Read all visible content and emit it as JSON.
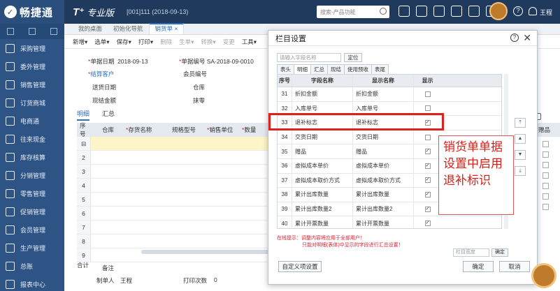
{
  "brand": {
    "logo": "畅捷通",
    "product": "T⁺",
    "product_sub": "专业版",
    "account": "[001]111   (2018-09-13)"
  },
  "topbar": {
    "search_placeholder": "搜索-产品功能",
    "user": "王程",
    "help": "?"
  },
  "sidebar": {
    "items": [
      "采购管理",
      "委外管理",
      "销售管理",
      "订货商城",
      "电商通",
      "往来现金",
      "库存核算",
      "分销管理",
      "零售管理",
      "促销管理",
      "会员管理",
      "生产管理",
      "总账",
      "报表中心"
    ]
  },
  "tabs": [
    "我的桌面",
    "初始化导航",
    "销货单 ×"
  ],
  "toolbar": {
    "items": [
      "新增▾",
      "选单▾",
      "保存▾",
      "打印▾",
      "删除",
      "生单▾",
      "转换▾",
      "变更",
      "工具▾"
    ]
  },
  "form": {
    "date_label": "单据日期",
    "date_value": "2018-09-13",
    "code_label": "单据编号",
    "code_value": "SA-2018-09-0010",
    "customer_label": "结算客户",
    "member_label": "会员编号",
    "delivery_label": "送货日期",
    "warehouse_label": "仓库",
    "cash_label": "现结金额",
    "discount_label": "抹零"
  },
  "subtabs": [
    "明细",
    "汇总"
  ],
  "grid": {
    "headers": [
      "序号",
      "仓库",
      "存货名称",
      "规格型号",
      "销售单位",
      "数量"
    ],
    "rows": [
      "2",
      "3",
      "4",
      "5",
      "6",
      "7",
      "8",
      "9"
    ],
    "total_label": "合计",
    "right_header": "赠品"
  },
  "bottom": {
    "note_label": "备注",
    "maker_label": "制单人",
    "maker_value": "王程",
    "print_label": "打印次数",
    "print_value": "0"
  },
  "dialog": {
    "title": "栏目设置",
    "search_placeholder": "请输入字段名称",
    "locate_label": "定位",
    "tabs": [
      "表头",
      "明细",
      "汇总",
      "现结",
      "使用预收",
      "表尾"
    ],
    "headers": [
      "序号",
      "字段名称",
      "显示名称",
      "显示"
    ],
    "rows": [
      {
        "no": "31",
        "field": "折扣金额",
        "display": "折扣金额",
        "checked": false
      },
      {
        "no": "32",
        "field": "入库单号",
        "display": "入库单号",
        "checked": false
      },
      {
        "no": "33",
        "field": "退补标志",
        "display": "退补标志",
        "checked": true
      },
      {
        "no": "34",
        "field": "交货日期",
        "display": "交货日期",
        "checked": false
      },
      {
        "no": "35",
        "field": "赠品",
        "display": "赠品",
        "checked": true
      },
      {
        "no": "36",
        "field": "虚拟成本单价",
        "display": "虚拟成本单价",
        "checked": true
      },
      {
        "no": "37",
        "field": "虚拟成本取价方式",
        "display": "虚拟成本取价方式",
        "checked": true
      },
      {
        "no": "38",
        "field": "累计出库数量",
        "display": "累计出库数量",
        "checked": true
      },
      {
        "no": "39",
        "field": "累计出库数量2",
        "display": "累计出库数量2",
        "checked": true
      },
      {
        "no": "40",
        "field": "累计开票数量",
        "display": "累计开票数量",
        "checked": true
      }
    ],
    "move_buttons": [
      "⌃̄",
      "⌃",
      "⌄",
      "⌄̲"
    ],
    "tip1": "在线提示：调整内容将应用于全部用户！",
    "tip2": "只能对明细(表体)中显示的字段进行汇总设置！",
    "width_placeholder": "栏目宽度",
    "width_ok": "确定",
    "custom_btn": "自定义项设置",
    "ok_btn": "确定",
    "cancel_btn": "取消"
  },
  "annotation": {
    "text": "销货单单据设置中启用退补标识"
  }
}
